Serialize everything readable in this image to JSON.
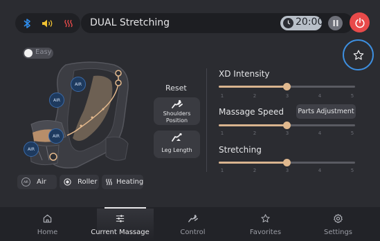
{
  "header": {
    "status_icons": [
      "bluetooth-icon",
      "speaker-icon",
      "heating-icon"
    ],
    "program_title": "DUAL Stretching",
    "timer": "20:00",
    "colors": {
      "bluetooth": "#2f8ff0",
      "heat": "#e84a4a",
      "power": "#e84a4a",
      "accent": "#d9b48f",
      "focus_ring": "#3d8fe0"
    }
  },
  "easy_toggle": {
    "label": "Easy",
    "on": false
  },
  "chair": {
    "air_badges": [
      "AIR",
      "AIR",
      "AIR",
      "AIR"
    ]
  },
  "position_controls": {
    "reset_label": "Reset",
    "shoulders_label_line1": "Shoulders",
    "shoulders_label_line2": "Position",
    "leg_length_label": "Leg Length"
  },
  "sliders": [
    {
      "title": "XD Intensity",
      "value": 3,
      "ticks": [
        "1",
        "2",
        "3",
        "4",
        "5"
      ]
    },
    {
      "title": "Massage Speed",
      "value": 3,
      "ticks": [
        "1",
        "2",
        "3",
        "4",
        "5"
      ]
    },
    {
      "title": "Stretching",
      "value": 3,
      "ticks": [
        "1",
        "2",
        "3",
        "4",
        "5"
      ]
    }
  ],
  "parts_adjustment_label": "Parts Adjustment",
  "modes": {
    "air": {
      "label": "Air",
      "icon_text": "AIR"
    },
    "roller": {
      "label": "Roller"
    },
    "heating": {
      "label": "Heating"
    }
  },
  "nav": {
    "active": "current_massage",
    "items": [
      {
        "key": "home",
        "label": "Home",
        "icon": "home-icon"
      },
      {
        "key": "current_massage",
        "label": "Current Massage",
        "icon": "sliders-icon"
      },
      {
        "key": "control",
        "label": "Control",
        "icon": "control-icon"
      },
      {
        "key": "favorites",
        "label": "Favorites",
        "icon": "star-icon"
      },
      {
        "key": "settings",
        "label": "Settings",
        "icon": "gear-icon"
      }
    ]
  }
}
